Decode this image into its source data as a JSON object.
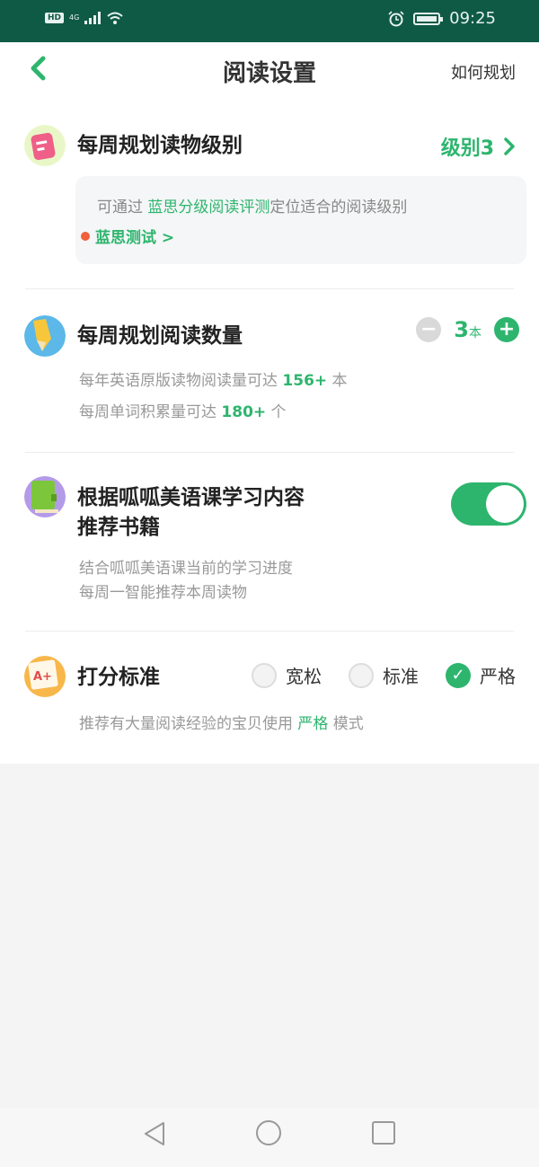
{
  "status": {
    "hd": "HD",
    "net": "4G",
    "time": "09:25",
    "icons": [
      "signal-icon",
      "wifi-icon",
      "alarm-icon",
      "battery-icon"
    ]
  },
  "header": {
    "title": "阅读设置",
    "link": "如何规划"
  },
  "level_section": {
    "title": "每周规划读物级别",
    "level": "级别3",
    "card_prefix": "可通过 ",
    "card_link": "蓝思分级阅读评测",
    "card_suffix": "定位适合的阅读级别",
    "test_link": "蓝思测试 >"
  },
  "count_section": {
    "title": "每周规划阅读数量",
    "count": "3",
    "unit": "本",
    "line1_prefix": "每年英语原版读物阅读量可达 ",
    "line1_value": "156+",
    "line1_suffix": " 本",
    "line2_prefix": "每周单词积累量可达 ",
    "line2_value": "180+",
    "line2_suffix": " 个"
  },
  "recommend_section": {
    "title_line1": "根据呱呱美语课学习内容",
    "title_line2": "推荐书籍",
    "toggle_on": true,
    "desc_line1": "结合呱呱美语课当前的学习进度",
    "desc_line2": "每周一智能推荐本周读物"
  },
  "score_section": {
    "title": "打分标准",
    "options": [
      "宽松",
      "标准",
      "严格"
    ],
    "selected": "严格",
    "desc_prefix": "推荐有大量阅读经验的宝贝使用 ",
    "desc_value": "严格",
    "desc_suffix": " 模式"
  },
  "colors": {
    "accent": "#2db56e",
    "statusbar": "#0f5a45",
    "dot": "#f0603c"
  }
}
